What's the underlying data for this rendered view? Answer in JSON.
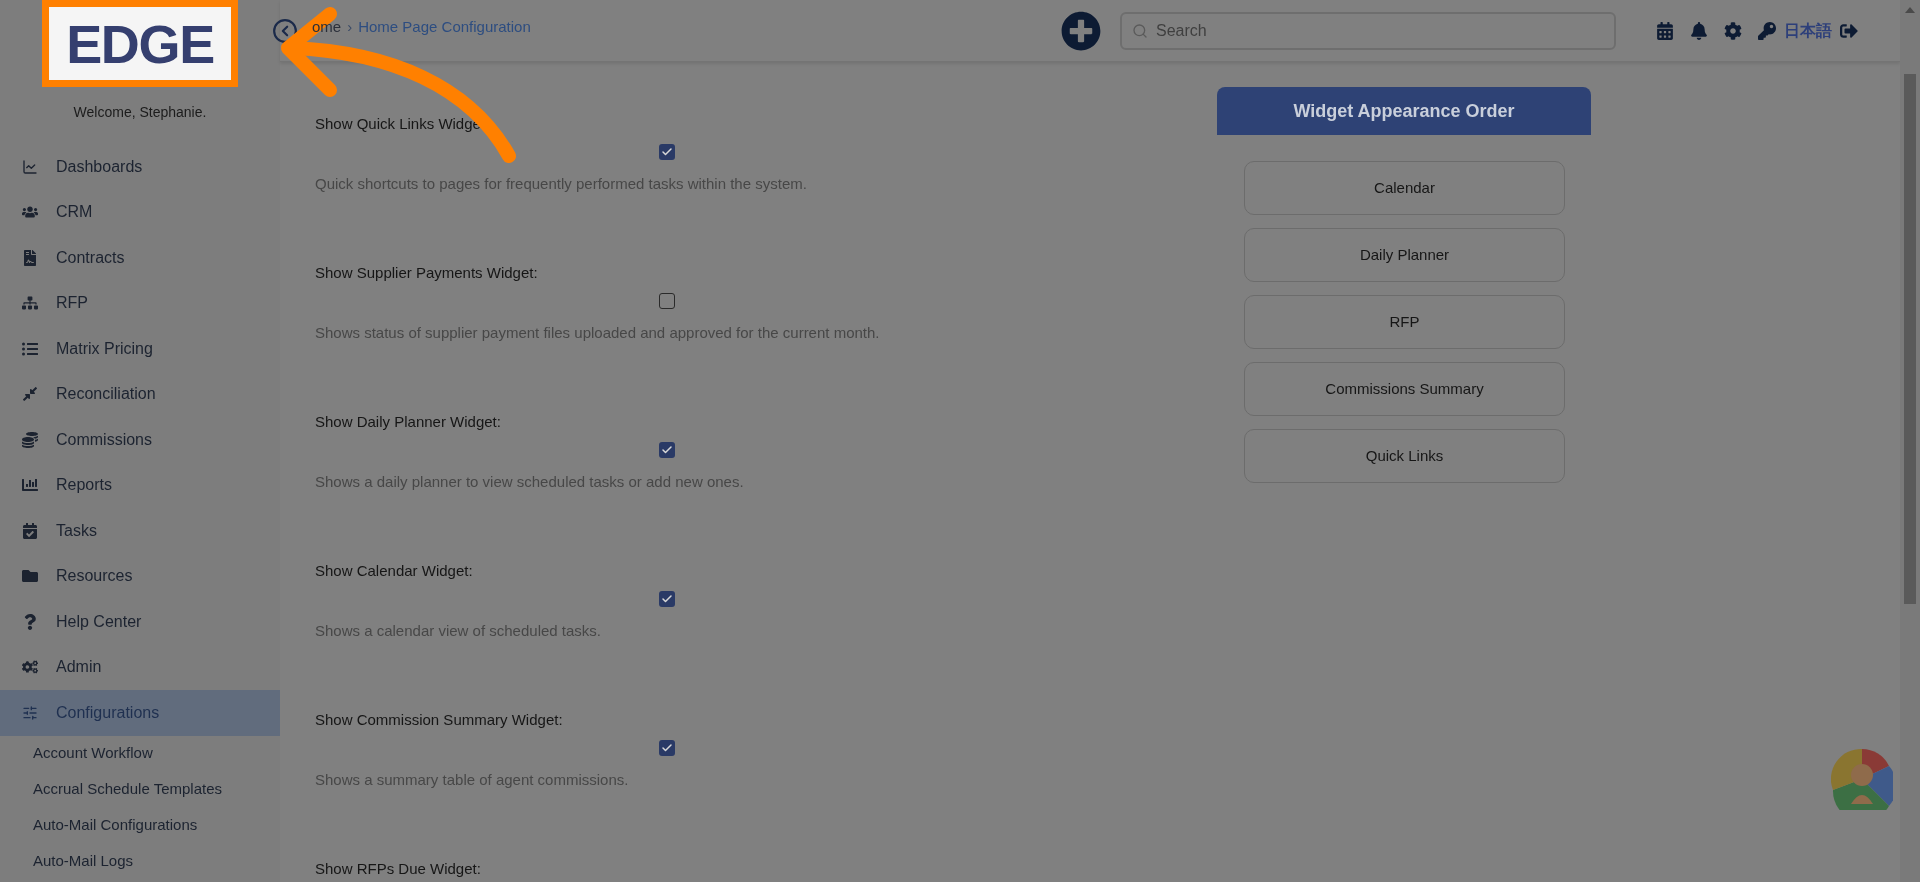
{
  "logo": {
    "text": "EDGE"
  },
  "welcome": "Welcome, Stephanie.",
  "nav": [
    {
      "label": "Dashboards",
      "selected": false
    },
    {
      "label": "CRM",
      "selected": false
    },
    {
      "label": "Contracts",
      "selected": false
    },
    {
      "label": "RFP",
      "selected": false
    },
    {
      "label": "Matrix Pricing",
      "selected": false
    },
    {
      "label": "Reconciliation",
      "selected": false
    },
    {
      "label": "Commissions",
      "selected": false
    },
    {
      "label": "Reports",
      "selected": false
    },
    {
      "label": "Tasks",
      "selected": false
    },
    {
      "label": "Resources",
      "selected": false
    },
    {
      "label": "Help Center",
      "selected": false
    },
    {
      "label": "Admin",
      "selected": false
    },
    {
      "label": "Configurations",
      "selected": true,
      "children": [
        {
          "label": "Account Workflow",
          "selected": false
        },
        {
          "label": "Accrual Schedule Templates",
          "selected": false
        },
        {
          "label": "Auto-Mail Configurations",
          "selected": false
        },
        {
          "label": "Auto-Mail Logs",
          "selected": false
        }
      ]
    }
  ],
  "breadcrumb": {
    "items": [
      "ome",
      "Home Page Configuration"
    ],
    "separator": "›"
  },
  "search": {
    "placeholder": "Search"
  },
  "language": "日本語",
  "widgets": [
    {
      "label": "Show Quick Links Widge",
      "checked": true,
      "description": "Quick shortcuts to pages for frequently performed tasks within the system."
    },
    {
      "label": "Show Supplier Payments Widget:",
      "checked": false,
      "description": "Shows status of supplier payment files uploaded and approved for the current month."
    },
    {
      "label": "Show Daily Planner Widget:",
      "checked": true,
      "description": "Shows a daily planner to view scheduled tasks or add new ones."
    },
    {
      "label": "Show Calendar Widget:",
      "checked": true,
      "description": "Shows a calendar view of scheduled tasks."
    },
    {
      "label": "Show Commission Summary Widget:",
      "checked": true,
      "description": "Shows a summary table of agent commissions."
    },
    {
      "label": "Show RFPs Due Widget:"
    }
  ],
  "order_panel": {
    "title": "Widget Appearance Order",
    "items": [
      "Calendar",
      "Daily Planner",
      "RFP",
      "Commissions Summary",
      "Quick Links"
    ]
  }
}
